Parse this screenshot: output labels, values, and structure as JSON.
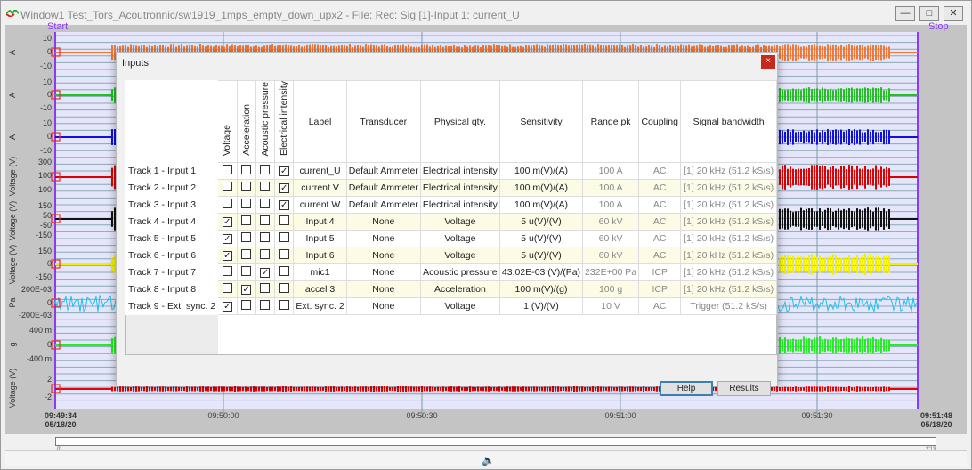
{
  "window": {
    "title": "Window1 Test_Tors_Acoutronnic/sw1919_1mps_empty_down_upx2 - File: Rec: Sig [1]-Input 1: current_U",
    "minimize": "—",
    "maximize": "□",
    "close": "✕"
  },
  "markers": {
    "start": "Start",
    "stop": "Stop"
  },
  "tracks": [
    {
      "unit": "A",
      "ticks": [
        "10",
        "0",
        "-10"
      ],
      "color": "#f07838"
    },
    {
      "unit": "A",
      "ticks": [
        "10",
        "0",
        "-10"
      ],
      "color": "#22c022"
    },
    {
      "unit": "A",
      "ticks": [
        "10",
        "0",
        "-10"
      ],
      "color": "#1010e0"
    },
    {
      "unit": "Voltage (V)",
      "ticks": [
        "300",
        "100",
        "-100"
      ],
      "color": "#dd0000"
    },
    {
      "unit": "Voltage (V)",
      "ticks": [
        "150",
        "50",
        "-50",
        "-150"
      ],
      "color": "#111111"
    },
    {
      "unit": "Voltage (V)",
      "ticks": [
        "150",
        "0",
        "-150"
      ],
      "color": "#f0f000"
    },
    {
      "unit": "Pa",
      "ticks": [
        "200E-03",
        "0",
        "-200E-03"
      ],
      "color": "#20c0f0"
    },
    {
      "unit": "g",
      "ticks": [
        "400 m",
        "0",
        "-400 m"
      ],
      "color": "#22ee22"
    },
    {
      "unit": "Voltage (V)",
      "ticks": [
        "2",
        "-2"
      ],
      "color": "#ee0000"
    }
  ],
  "time_axis": {
    "start_time": "09:49:34",
    "start_date": "05/18/20",
    "ticks": [
      "09:50:00",
      "09:50:30",
      "09:51:00",
      "09:51:30"
    ],
    "end_time": "09:51:48",
    "end_date": "05/18/20"
  },
  "scrollbar": {
    "left": "0'",
    "right": "2'13'"
  },
  "status": {
    "speaker_icon": "speaker-icon"
  },
  "dialog": {
    "title": "Inputs",
    "close": "×",
    "headers": [
      "Voltage",
      "Acceleration",
      "Acoustic pressure",
      "Electrical intensity",
      "Label",
      "Transducer",
      "Physical qty.",
      "Sensitivity",
      "Range pk",
      "Coupling",
      "Signal bandwidth"
    ],
    "rows": [
      {
        "name": "Track 1 - Input 1",
        "checks": [
          false,
          false,
          false,
          true
        ],
        "label": "current_U",
        "transducer": "Default Ammeter",
        "qty": "Electrical intensity",
        "sensitivity": "100 m(V)/(A)",
        "range": "100 A",
        "coupling": "AC",
        "bandwidth": "[1] 20 kHz (51.2 kS/s)"
      },
      {
        "name": "Track 2 - Input 2",
        "checks": [
          false,
          false,
          false,
          true
        ],
        "label": "current V",
        "transducer": "Default Ammeter",
        "qty": "Electrical intensity",
        "sensitivity": "100 m(V)/(A)",
        "range": "100 A",
        "coupling": "AC",
        "bandwidth": "[1] 20 kHz (51.2 kS/s)"
      },
      {
        "name": "Track 3 - Input 3",
        "checks": [
          false,
          false,
          false,
          true
        ],
        "label": "current W",
        "transducer": "Default Ammeter",
        "qty": "Electrical intensity",
        "sensitivity": "100 m(V)/(A)",
        "range": "100 A",
        "coupling": "AC",
        "bandwidth": "[1] 20 kHz (51.2 kS/s)"
      },
      {
        "name": "Track 4 - Input 4",
        "checks": [
          true,
          false,
          false,
          false
        ],
        "label": "Input 4",
        "transducer": "None",
        "qty": "Voltage",
        "sensitivity": "5 u(V)/(V)",
        "range": "60 kV",
        "coupling": "AC",
        "bandwidth": "[1] 20 kHz (51.2 kS/s)"
      },
      {
        "name": "Track 5 - Input 5",
        "checks": [
          true,
          false,
          false,
          false
        ],
        "label": "Input 5",
        "transducer": "None",
        "qty": "Voltage",
        "sensitivity": "5 u(V)/(V)",
        "range": "60 kV",
        "coupling": "AC",
        "bandwidth": "[1] 20 kHz (51.2 kS/s)"
      },
      {
        "name": "Track 6 - Input 6",
        "checks": [
          true,
          false,
          false,
          false
        ],
        "label": "Input 6",
        "transducer": "None",
        "qty": "Voltage",
        "sensitivity": "5 u(V)/(V)",
        "range": "60 kV",
        "coupling": "AC",
        "bandwidth": "[1] 20 kHz (51.2 kS/s)"
      },
      {
        "name": "Track 7 - Input 7",
        "checks": [
          false,
          false,
          true,
          false
        ],
        "label": "mic1",
        "transducer": "None",
        "qty": "Acoustic pressure",
        "sensitivity": "43.02E-03 (V)/(Pa)",
        "range": "232E+00 Pa",
        "coupling": "ICP",
        "bandwidth": "[1] 20 kHz (51.2 kS/s)"
      },
      {
        "name": "Track 8 - Input 8",
        "checks": [
          false,
          true,
          false,
          false
        ],
        "label": "accel 3",
        "transducer": "None",
        "qty": "Acceleration",
        "sensitivity": "100 m(V)/(g)",
        "range": "100 g",
        "coupling": "ICP",
        "bandwidth": "[1] 20 kHz (51.2 kS/s)"
      },
      {
        "name": "Track 9 - Ext. sync. 2",
        "checks": [
          true,
          false,
          false,
          false
        ],
        "label": "Ext. sync. 2",
        "transducer": "None",
        "qty": "Voltage",
        "sensitivity": "1 (V)/(V)",
        "range": "10 V",
        "coupling": "AC",
        "bandwidth": "Trigger (51.2 kS/s)"
      }
    ],
    "check_mark": "✓",
    "help": "Help",
    "results": "Results"
  }
}
